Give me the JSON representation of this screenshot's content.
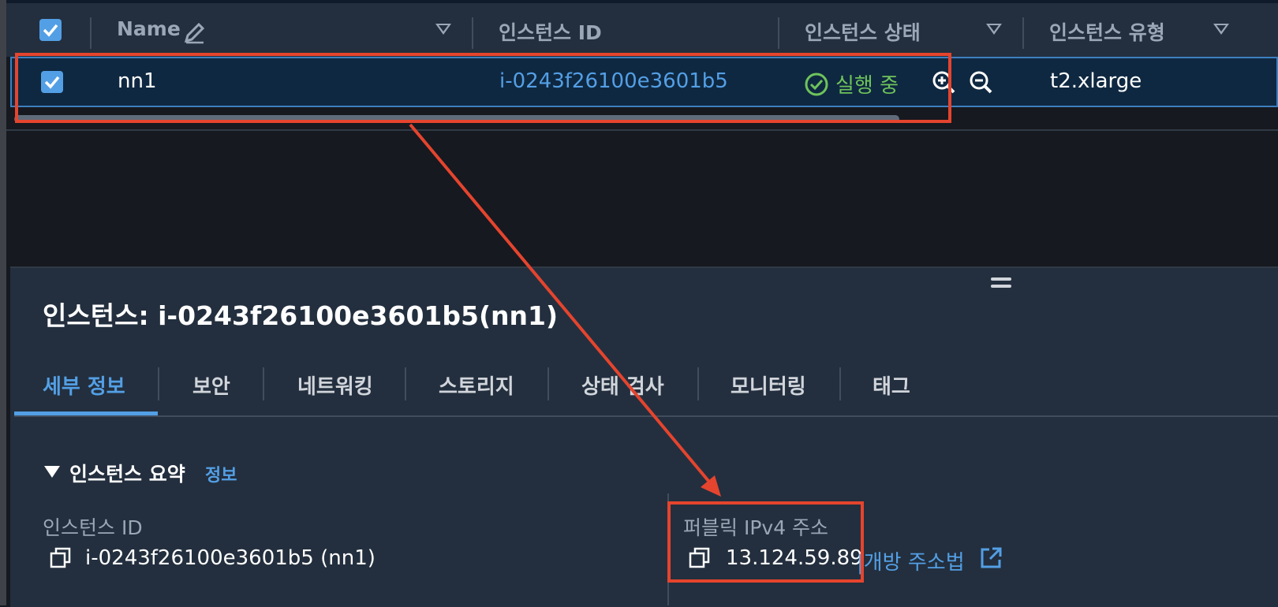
{
  "table": {
    "columns": [
      "Name",
      "인스턴스 ID",
      "인스턴스 상태",
      "인스턴스 유형"
    ],
    "row": {
      "name": "nn1",
      "instance_id": "i-0243f26100e3601b5",
      "state": "실행 중",
      "type": "t2.xlarge"
    }
  },
  "panel": {
    "title": "인스턴스: i-0243f26100e3601b5(nn1)",
    "tabs": [
      "세부 정보",
      "보안",
      "네트워킹",
      "스토리지",
      "상태 검사",
      "모니터링",
      "태그"
    ],
    "active_tab": "세부 정보",
    "section": {
      "title": "인스턴스 요약",
      "info_link": "정보"
    },
    "fields": {
      "instance_id_label": "인스턴스 ID",
      "instance_id_value": "i-0243f26100e3601b5 (nn1)",
      "public_ipv4_label": "퍼블릭 IPv4 주소",
      "public_ipv4_value": "13.124.59.89",
      "open_address_link": "|개방 주소법"
    }
  },
  "colors": {
    "accent": "#539fe5",
    "running": "#6ec35b",
    "annotation": "#e5442e",
    "header_bg": "#232f3e",
    "selected_row_bg": "#0f2841"
  }
}
